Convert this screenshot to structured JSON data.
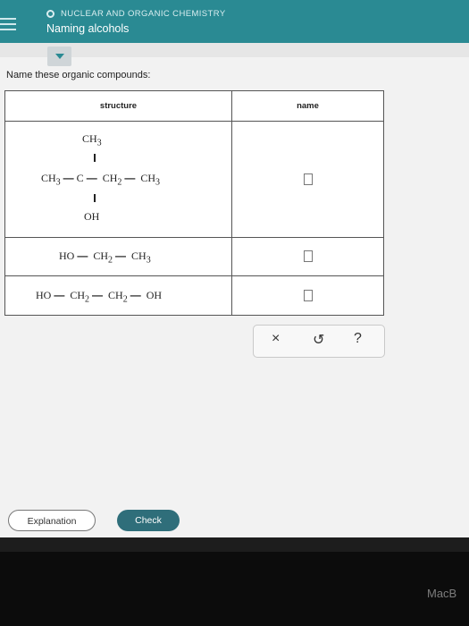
{
  "header": {
    "topic": "NUCLEAR AND ORGANIC CHEMISTRY",
    "title": "Naming alcohols"
  },
  "prompt": "Name these organic compounds:",
  "table": {
    "headers": {
      "structure": "structure",
      "name": "name"
    },
    "rows": [
      {
        "top": "CH3",
        "main": "CH3 — C — CH2 — CH3",
        "bottom": "OH",
        "name_value": ""
      },
      {
        "main": "HO — CH2 — CH3",
        "name_value": ""
      },
      {
        "main": "HO — CH2 — CH2 — OH",
        "name_value": ""
      }
    ]
  },
  "toolbar": {
    "clear": "×",
    "undo": "↺",
    "help": "?"
  },
  "buttons": {
    "explanation": "Explanation",
    "check": "Check"
  },
  "device": {
    "brand": "MacB"
  },
  "colors": {
    "header": "#2a8a93",
    "check_button": "#2f6e7a"
  }
}
